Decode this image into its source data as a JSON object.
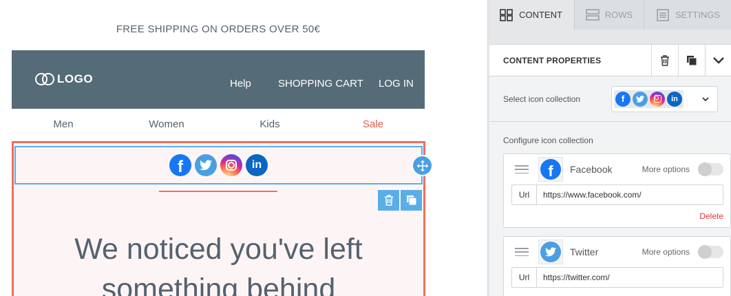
{
  "canvas": {
    "topbar_text": "FREE SHIPPING ON ORDERS OVER 50€",
    "header": {
      "logo_text": "LOGO",
      "nav": [
        "Help",
        "SHOPPING CART",
        "LOG IN"
      ]
    },
    "categories": [
      "Men",
      "Women",
      "Kids",
      "Sale"
    ],
    "social_icons": [
      "facebook-icon",
      "twitter-icon",
      "instagram-icon",
      "linkedin-icon"
    ],
    "headline": "We noticed you've left something behind",
    "accent_color": "#ee6f5e",
    "header_color": "#556b78",
    "selection_color": "#5aaee8"
  },
  "sidebar": {
    "tabs": [
      {
        "label": "CONTENT",
        "icon": "grid-icon",
        "active": true
      },
      {
        "label": "ROWS",
        "icon": "rows-icon",
        "active": false
      },
      {
        "label": "SETTINGS",
        "icon": "settings-doc-icon",
        "active": false
      }
    ],
    "properties_title": "CONTENT PROPERTIES",
    "select_collection_label": "Select icon collection",
    "configure_label": "Configure icon collection",
    "icons": [
      {
        "name": "Facebook",
        "more_options": "More options",
        "url_label": "Url",
        "url": "https://www.facebook.com/",
        "delete_label": "Delete",
        "toggle_on": false
      },
      {
        "name": "Twitter",
        "more_options": "More options",
        "url_label": "Url",
        "url": "https://twitter.com/",
        "toggle_on": false
      }
    ]
  }
}
